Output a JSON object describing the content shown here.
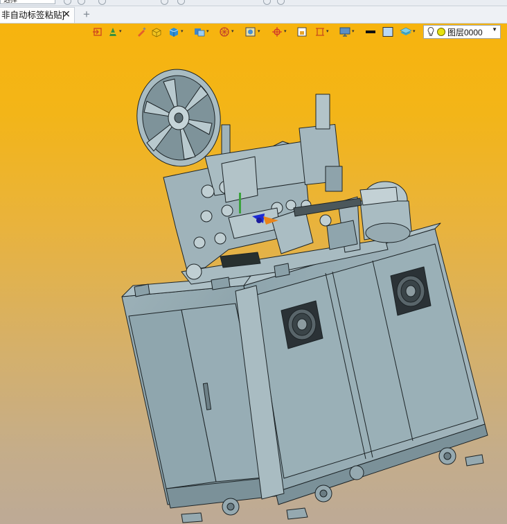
{
  "menu": {
    "dropdown_label": "选择"
  },
  "tabs": [
    {
      "label": "非自动标签粘贴]",
      "close": "✕"
    }
  ],
  "new_tab": "+",
  "toolbar": {
    "layer_selector": {
      "value": "图层0000"
    }
  },
  "colors": {
    "viewport_top": "#f7b40e",
    "viewport_bottom": "#bdaa96",
    "model_fill": "#8fa5ad",
    "model_line": "#1c2326"
  }
}
